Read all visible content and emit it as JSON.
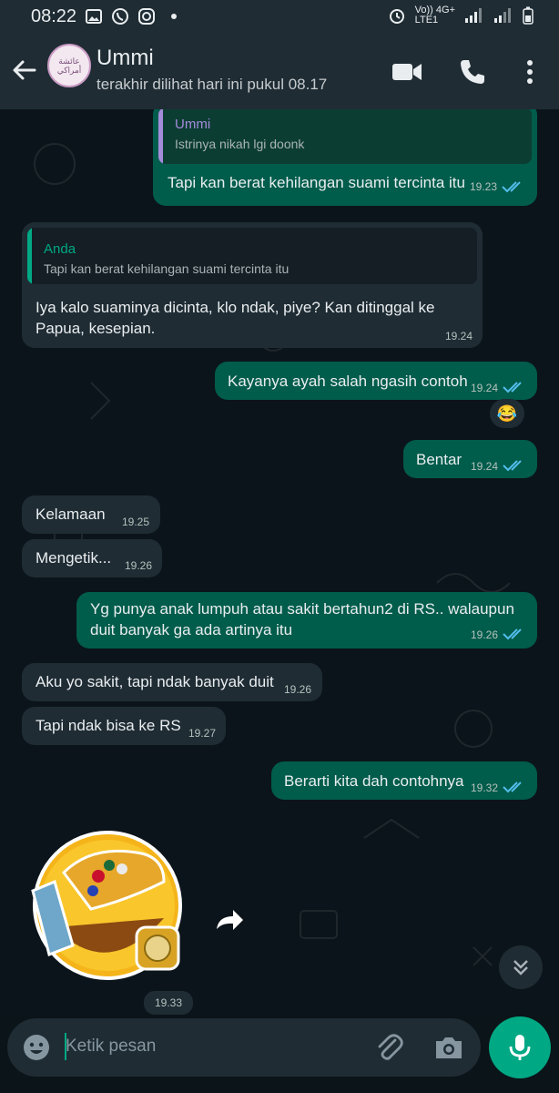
{
  "status": {
    "time": "08:22",
    "network": "Vo)) 4G+",
    "network2": "LTE1"
  },
  "header": {
    "name": "Ummi",
    "last_seen": "terakhir dilihat hari ini pukul 08.17",
    "avatar_text": "عائشة أمراكي"
  },
  "messages": [
    {
      "quote_name": "Ummi",
      "quote_text": "Istrinya nikah lgi doonk",
      "text": "Tapi kan berat kehilangan suami tercinta itu",
      "time": "19.23"
    },
    {
      "quote_name": "Anda",
      "quote_text": "Tapi kan berat kehilangan suami tercinta itu",
      "text1": "Iya kalo suaminya dicinta, klo ndak, piye? Kan ditinggal ke",
      "text2": "Papua, kesepian.",
      "time": "19.24"
    },
    {
      "text": "Kayanya ayah salah ngasih contoh",
      "time": "19.24",
      "reaction": "😂"
    },
    {
      "text": "Bentar",
      "time": "19.24"
    },
    {
      "text": "Kelamaan",
      "time": "19.25"
    },
    {
      "text": "Mengetik...",
      "time": "19.26"
    },
    {
      "text1": "Yg punya anak lumpuh atau sakit bertahun2 di RS.. walaupun",
      "text2": "duit banyak ga ada artinya itu",
      "time": "19.26"
    },
    {
      "text": "Aku yo sakit, tapi ndak banyak duit",
      "time": "19.26"
    },
    {
      "text": "Tapi ndak bisa ke RS",
      "time": "19.27"
    },
    {
      "text": "Berarti kita dah contohnya",
      "time": "19.32"
    },
    {
      "sticker": "laughing-emoji-with-jewelry",
      "time": "19.33"
    }
  ],
  "input": {
    "placeholder": "Ketik pesan"
  },
  "colors": {
    "outgoing": "#005c4b",
    "incoming": "#1f2c34",
    "accent": "#00a884",
    "read_ticks": "#53bdeb"
  }
}
